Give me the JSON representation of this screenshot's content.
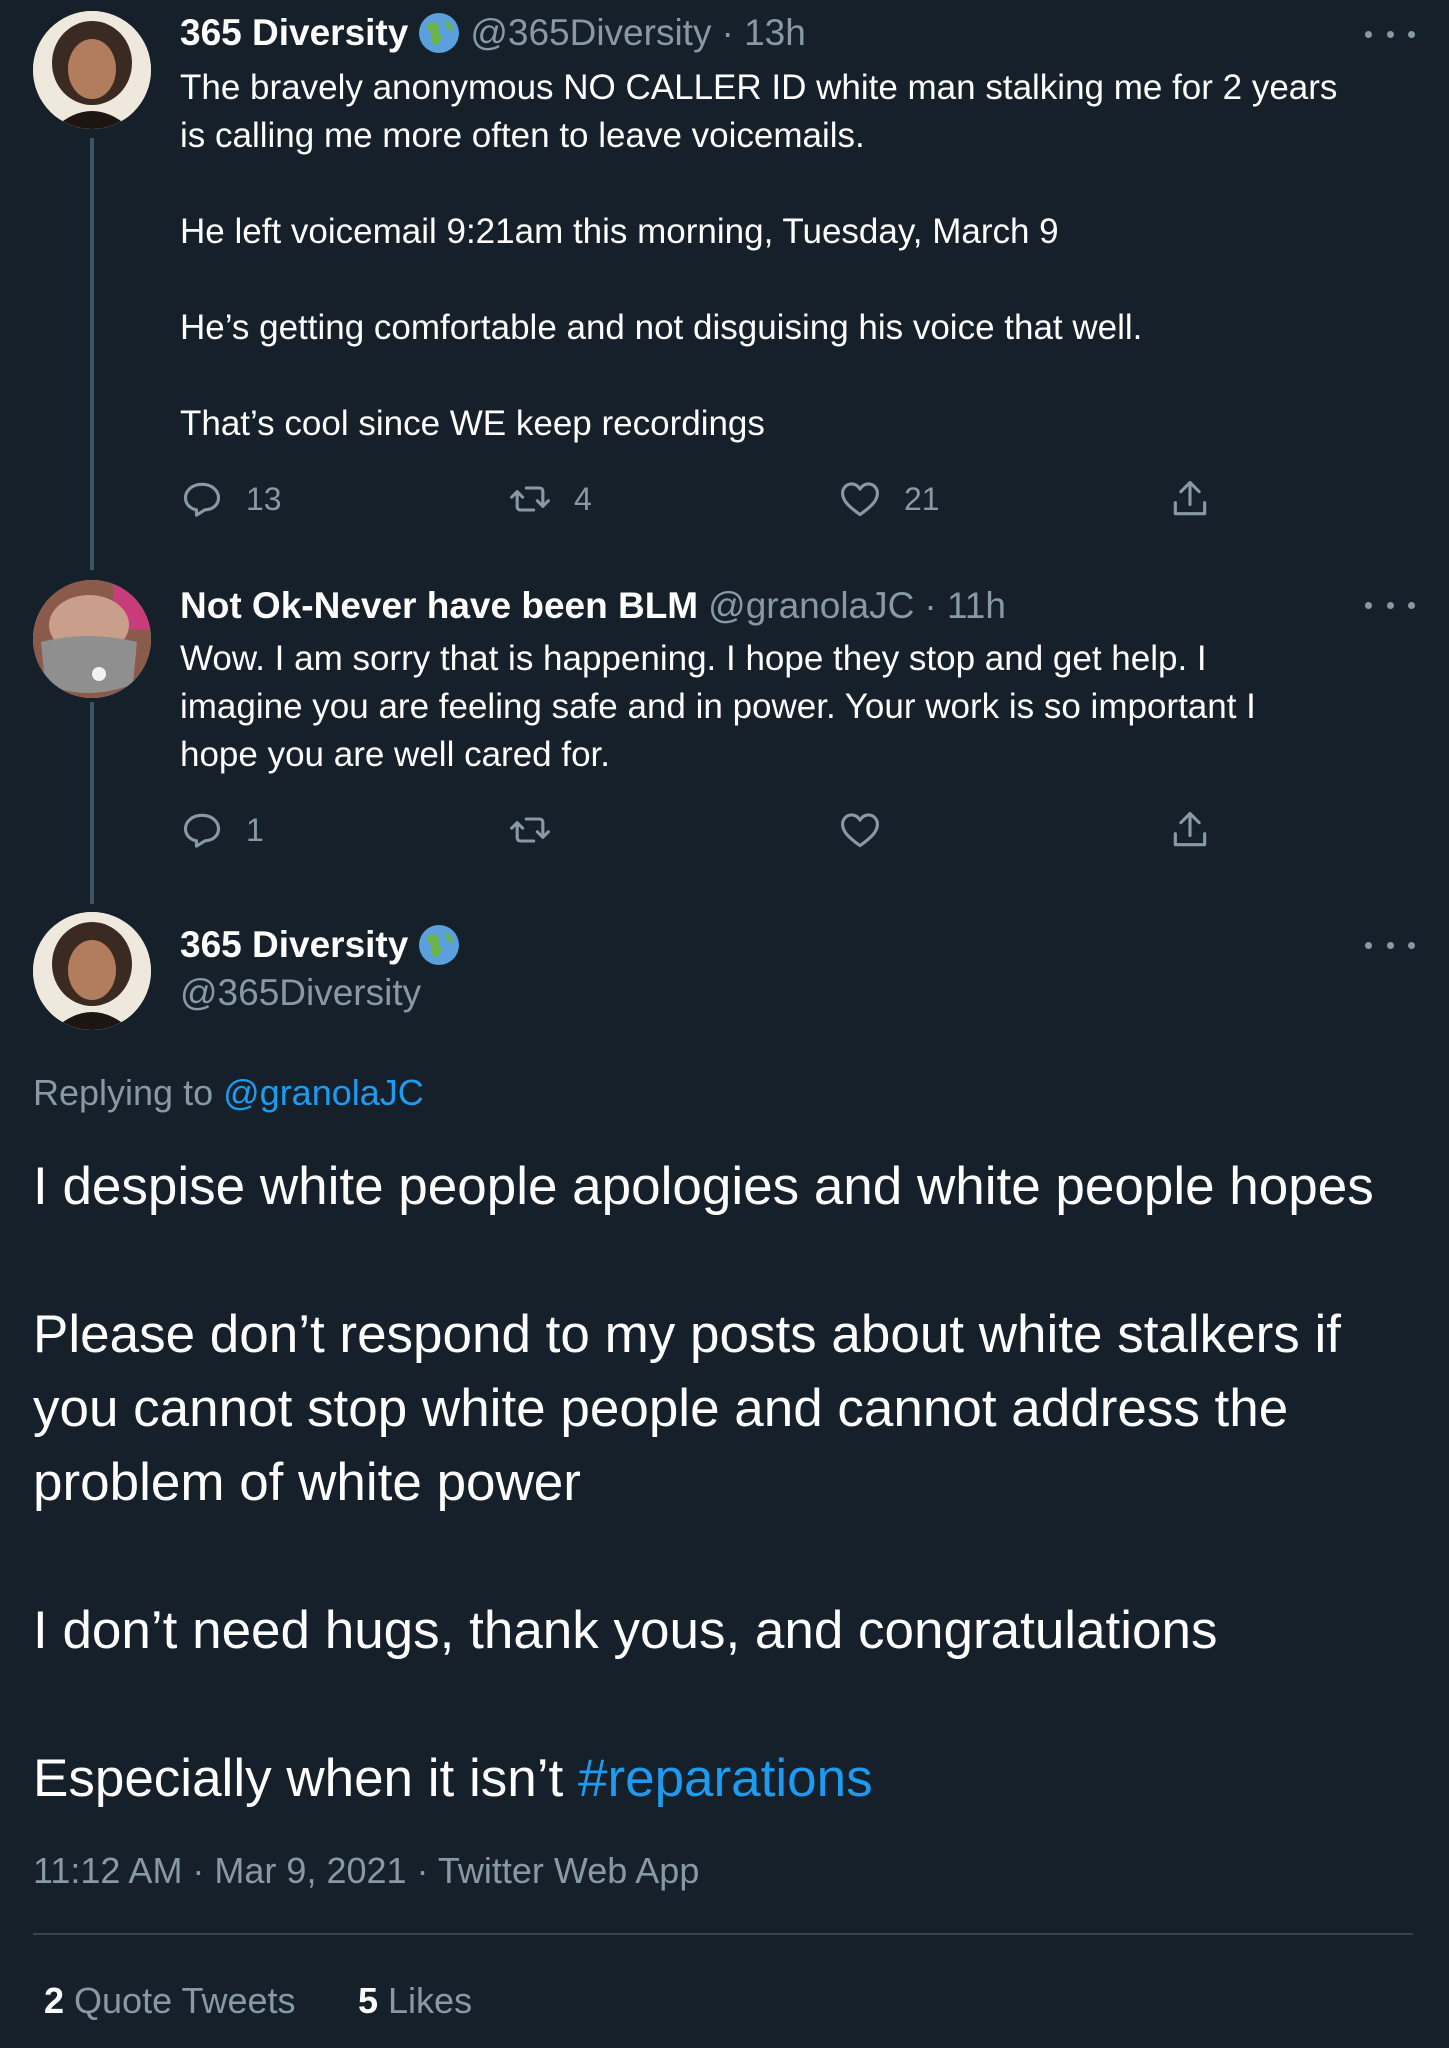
{
  "tweet1": {
    "name": "365 Diversity",
    "handle": "@365Diversity",
    "time": "· 13h",
    "text": "The bravely anonymous NO CALLER ID white man stalking me for 2 years\nis calling me more often to leave voicemails.\n\nHe left voicemail 9:21am this morning, Tuesday, March 9\n\nHe’s getting comfortable and not disguising his voice that well.\n\nThat’s cool since WE keep recordings",
    "replies": "13",
    "retweets": "4",
    "likes": "21"
  },
  "tweet2": {
    "name": "Not Ok-Never have been BLM",
    "handle": "@granolaJC",
    "time": "· 11h",
    "text": "Wow. I am sorry that is happening. I hope they stop and get help. I\nimagine you are feeling safe and in power. Your work is so important I\nhope you are well cared for.",
    "replies": "1"
  },
  "main": {
    "name": "365 Diversity",
    "handle": "@365Diversity",
    "replying_prefix": "Replying to",
    "replying_handle": "@granolaJC",
    "text": "I despise white people apologies and white people hopes\n\nPlease don’t respond to my posts about white stalkers if\nyou cannot stop white people and cannot address the\nproblem of white power\n\nI don’t need hugs, thank yous, and congratulations\n\nEspecially when it isn’t ",
    "hashtag": "#reparations",
    "timestamp": "11:12 AM · Mar 9, 2021 · Twitter Web App",
    "quote_count": "2",
    "quote_label": "Quote Tweets",
    "like_count": "5",
    "like_label": "Likes"
  },
  "colors": {
    "background": "#15202b",
    "muted": "#8899a6",
    "link": "#1d9bf0",
    "thread_line": "#3d5466"
  },
  "icons": [
    "globe-emoji-icon",
    "more-icon",
    "reply-icon",
    "retweet-icon",
    "like-icon",
    "share-icon"
  ]
}
